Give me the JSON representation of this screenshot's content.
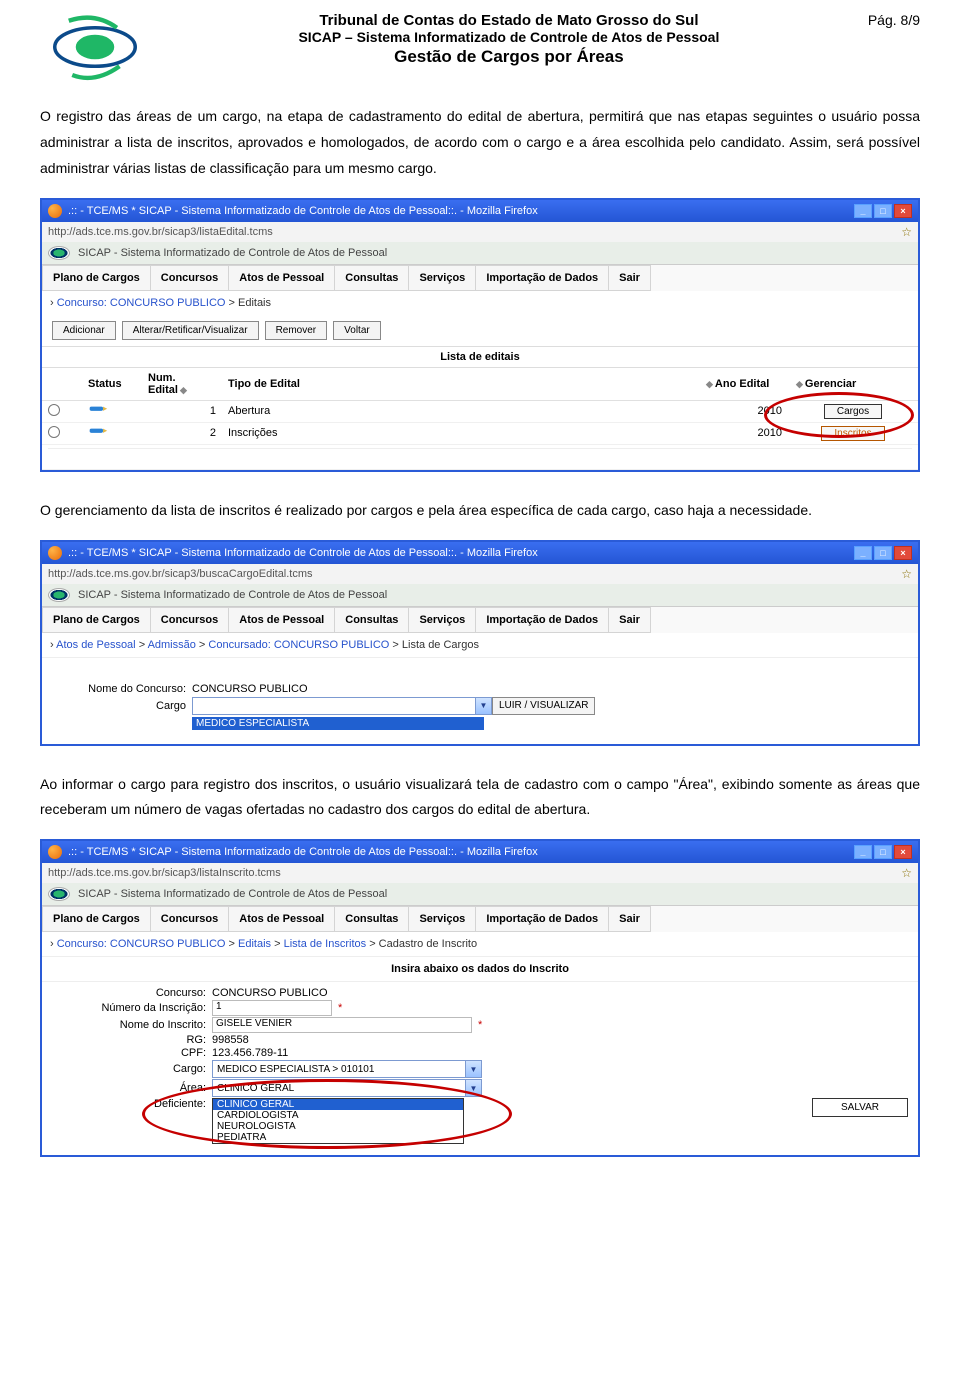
{
  "header": {
    "line1": "Tribunal de Contas do Estado de Mato Grosso do Sul",
    "line2": "SICAP – Sistema Informatizado de Controle de Atos de Pessoal",
    "line3": "Gestão de Cargos por Áreas",
    "page_label": "Pág. 8/9"
  },
  "para1": "O registro das áreas de um cargo, na etapa de cadastramento do edital de abertura, permitirá que nas etapas seguintes o usuário possa administrar a lista de inscritos, aprovados e homologados, de acordo com o cargo e a área escolhida pelo candidato. Assim, será possível administrar várias listas de classificação para um mesmo cargo.",
  "para2": "O gerenciamento da lista de inscritos é realizado por cargos e pela área específica de cada cargo, caso haja a necessidade.",
  "para3": "Ao informar o cargo para registro dos inscritos, o usuário visualizará tela de cadastro com o campo \"Área\", exibindo somente as áreas que receberam um número de vagas ofertadas no cadastro dos cargos do edital de abertura.",
  "common": {
    "window_title": ".:: - TCE/MS * SICAP - Sistema Informatizado de Controle de Atos de Pessoal::. - Mozilla Firefox",
    "app_banner": "SICAP - Sistema Informatizado de Controle de Atos de Pessoal",
    "menu": [
      "Plano de Cargos",
      "Concursos",
      "Atos de Pessoal",
      "Consultas",
      "Serviços",
      "Importação de Dados",
      "Sair"
    ]
  },
  "shot1": {
    "url": "http://ads.tce.ms.gov.br/sicap3/listaEdital.tcms",
    "crumb_link": "Concurso: CONCURSO PUBLICO",
    "crumb_tail": " > Editais",
    "toolbar": [
      "Adicionar",
      "Alterar/Retificar/Visualizar",
      "Remover",
      "Voltar"
    ],
    "list_title": "Lista de editais",
    "headers": {
      "status": "Status",
      "num": "Num. Edital",
      "tipo": "Tipo de Edital",
      "ano": "Ano Edital",
      "ger": "Gerenciar"
    },
    "rows": [
      {
        "num": "1",
        "tipo": "Abertura",
        "ano": "2010",
        "btn": "Cargos"
      },
      {
        "num": "2",
        "tipo": "Inscrições",
        "ano": "2010",
        "btn": "Inscritos"
      }
    ]
  },
  "shot2": {
    "url": "http://ads.tce.ms.gov.br/sicap3/buscaCargoEdital.tcms",
    "crumb_link1": "Atos de Pessoal",
    "crumb_link2": "Admissão",
    "crumb_link3": "Concursado: CONCURSO PUBLICO",
    "crumb_tail": " > Lista de Cargos",
    "nome_label": "Nome do Concurso:",
    "nome_value": "CONCURSO PUBLICO",
    "cargo_label": "Cargo",
    "cargo_selected": "MEDICO ESPECIALISTA",
    "side_btn": "LUIR / VISUALIZAR"
  },
  "shot3": {
    "url": "http://ads.tce.ms.gov.br/sicap3/listaInscrito.tcms",
    "crumb_link1": "Concurso: CONCURSO PUBLICO",
    "crumb_link2": "Editais",
    "crumb_link3": "Lista de Inscritos",
    "crumb_tail": " > Cadastro de Inscrito",
    "form_title": "Insira abaixo os dados do Inscrito",
    "labels": {
      "concurso": "Concurso:",
      "num": "Número da Inscrição:",
      "nome": "Nome do Inscrito:",
      "rg": "RG:",
      "cpf": "CPF:",
      "cargo": "Cargo:",
      "area": "Área:",
      "def": "Deficiente:"
    },
    "values": {
      "concurso": "CONCURSO PUBLICO",
      "num": "1",
      "nome": "GISELE VENIER",
      "rg": "998558",
      "cpf": "123.456.789-11",
      "cargo": "MEDICO ESPECIALISTA > 010101",
      "area": "CLINICO GERAL"
    },
    "area_options": [
      "CLINICO GERAL",
      "CARDIOLOGISTA",
      "NEUROLOGISTA",
      "PEDIATRA"
    ],
    "save": "SALVAR",
    "req": "*"
  }
}
